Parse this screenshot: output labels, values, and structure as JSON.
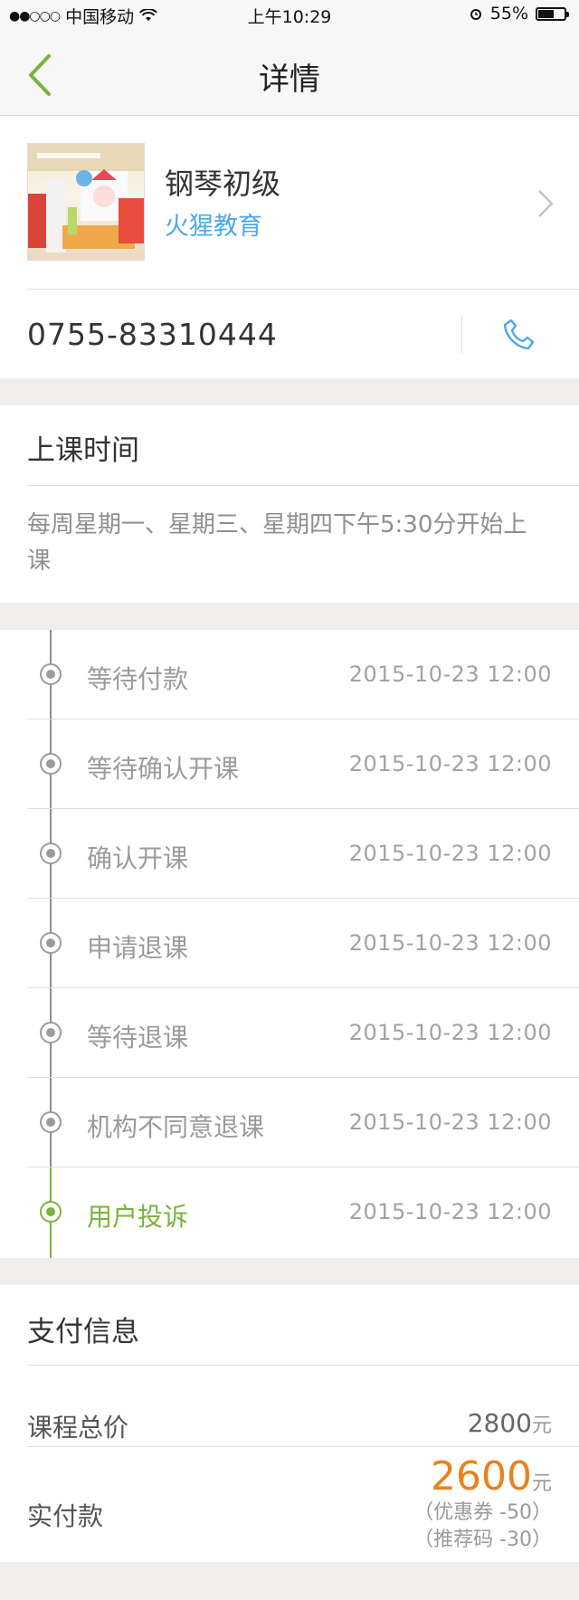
{
  "status_bar": {
    "carrier": "中国移动",
    "time": "上午10:29",
    "battery": "55%",
    "battery_level": 0.55
  },
  "nav": {
    "title": "详情",
    "back_icon": "chevron-left-icon"
  },
  "course": {
    "title": "钢琴初级",
    "organization": "火猩教育"
  },
  "contact": {
    "phone": "0755-83310444",
    "call_icon": "phone-icon"
  },
  "schedule": {
    "heading": "上课时间",
    "text": "每周星期一、星期三、星期四下午5:30分开始上课"
  },
  "timeline": [
    {
      "label": "等待付款",
      "time": "2015-10-23 12:00"
    },
    {
      "label": "等待确认开课",
      "time": "2015-10-23 12:00"
    },
    {
      "label": "确认开课",
      "time": "2015-10-23 12:00"
    },
    {
      "label": "申请退课",
      "time": "2015-10-23 12:00"
    },
    {
      "label": "等待退课",
      "time": "2015-10-23 12:00"
    },
    {
      "label": "机构不同意退课",
      "time": "2015-10-23 12:00"
    },
    {
      "label": "用户投诉",
      "time": "2015-10-23 12:00"
    }
  ],
  "payment": {
    "heading": "支付信息",
    "total_label": "课程总价",
    "total_value": "2800",
    "unit": "元",
    "actual_label": "实付款",
    "actual_value": "2600",
    "coupon_note": "（优惠券  -50）",
    "referral_note": "（推荐码  -30）"
  },
  "colors": {
    "accent_green": "#7ab33b",
    "link_blue": "#4aa9e8",
    "price_orange": "#e8821e"
  }
}
